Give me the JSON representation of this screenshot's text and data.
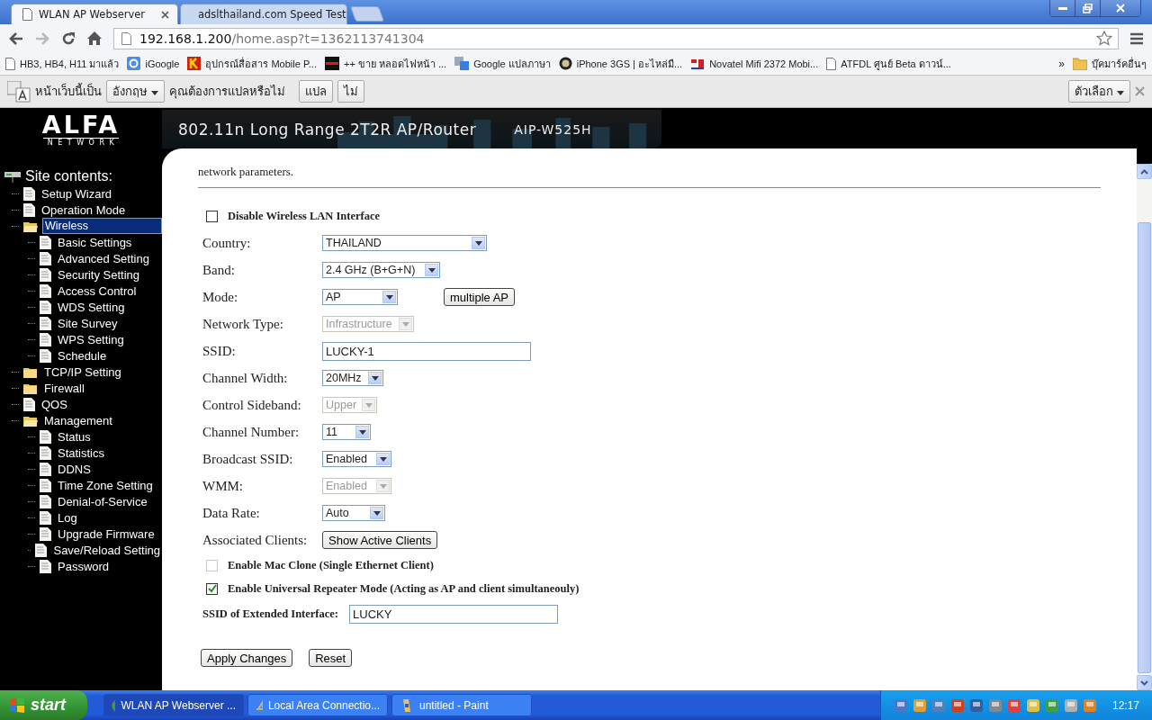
{
  "window": {
    "tabs": [
      {
        "title": "WLAN AP Webserver",
        "selected": true
      },
      {
        "title": "adslthailand.com Speed Test",
        "selected": false
      }
    ],
    "address": {
      "host": "192.168.1.200",
      "path": "/home.asp?t=1362113741304"
    },
    "bookmarks": [
      {
        "title": "HB3, HB4, H11 มาแล้ว",
        "kind": "page"
      },
      {
        "title": "iGoogle",
        "kind": "g"
      },
      {
        "title": "อุปกรณ์สื่อสาร Mobile P...",
        "kind": "k"
      },
      {
        "title": "++ ขาย หลอดไฟหน้า ...",
        "kind": "civic"
      },
      {
        "title": "Google แปลภาษา",
        "kind": "translate"
      },
      {
        "title": "iPhone 3GS | อะไหล่มื...",
        "kind": "round"
      },
      {
        "title": "Novatel Mifi 2372 Mobi...",
        "kind": "sn"
      },
      {
        "title": "ATFDL ศูนย์ Beta ดาวน์...",
        "kind": "page"
      }
    ],
    "more": "»",
    "other_bookmarks": "บุ๊คมาร์คอื่นๆ",
    "translate_bar": {
      "lead": "หน้าเว็บนี้เป็น",
      "language": "อังกฤษ",
      "question": "คุณต้องการแปลหรือไม่",
      "translate": "แปล",
      "decline": "ไม่",
      "options": "ตัวเลือก"
    }
  },
  "banner": {
    "logo": "ALFA",
    "logo_sub": "NETWORK",
    "title": "802.11n Long Range 2T2R AP/Router",
    "model": "AIP-W525H"
  },
  "sidebar": {
    "heading": "Site contents:",
    "items": [
      {
        "label": "Setup Wizard",
        "kind": "page",
        "selected": false
      },
      {
        "label": "Operation Mode",
        "kind": "page",
        "selected": false
      },
      {
        "label": "Wireless",
        "kind": "folder",
        "expanded": true,
        "selected": true,
        "children": [
          {
            "label": "Basic Settings",
            "kind": "page",
            "selected": false
          },
          {
            "label": "Advanced Setting",
            "kind": "page",
            "selected": false
          },
          {
            "label": "Security Setting",
            "kind": "page",
            "selected": false
          },
          {
            "label": "Access Control",
            "kind": "page",
            "selected": false
          },
          {
            "label": "WDS Setting",
            "kind": "page",
            "selected": false
          },
          {
            "label": "Site Survey",
            "kind": "page",
            "selected": false
          },
          {
            "label": "WPS Setting",
            "kind": "page",
            "selected": false
          },
          {
            "label": "Schedule",
            "kind": "page",
            "selected": false
          }
        ]
      },
      {
        "label": "TCP/IP Setting",
        "kind": "folder",
        "expanded": false,
        "selected": false
      },
      {
        "label": "Firewall",
        "kind": "folder",
        "expanded": false,
        "selected": false
      },
      {
        "label": "QOS",
        "kind": "page",
        "selected": false
      },
      {
        "label": "Management",
        "kind": "folder",
        "expanded": true,
        "selected": false,
        "children": [
          {
            "label": "Status",
            "kind": "page",
            "selected": false
          },
          {
            "label": "Statistics",
            "kind": "page",
            "selected": false
          },
          {
            "label": "DDNS",
            "kind": "page",
            "selected": false
          },
          {
            "label": "Time Zone Setting",
            "kind": "page",
            "selected": false
          },
          {
            "label": "Denial-of-Service",
            "kind": "page",
            "selected": false
          },
          {
            "label": "Log",
            "kind": "page",
            "selected": false
          },
          {
            "label": "Upgrade Firmware",
            "kind": "page",
            "selected": false
          },
          {
            "label": "Save/Reload Setting",
            "kind": "page",
            "selected": false
          },
          {
            "label": "Password",
            "kind": "page",
            "selected": false
          }
        ]
      }
    ]
  },
  "page": {
    "intro": "network parameters.",
    "disable_wlan": {
      "label": "Disable Wireless LAN Interface",
      "checked": false,
      "disabled": false
    },
    "fields": [
      {
        "label": "Country:",
        "kind": "select",
        "value": "THAILAND",
        "disabled": false
      },
      {
        "label": "Band:",
        "kind": "select",
        "value": "2.4 GHz (B+G+N)",
        "disabled": false
      },
      {
        "label": "Mode:",
        "kind": "select",
        "value": "AP",
        "disabled": false,
        "button": "multiple AP"
      },
      {
        "label": "Network Type:",
        "kind": "select",
        "value": "Infrastructure",
        "disabled": true
      },
      {
        "label": "SSID:",
        "kind": "text",
        "value": "LUCKY-1",
        "disabled": false
      },
      {
        "label": "Channel Width:",
        "kind": "select",
        "value": "20MHz",
        "disabled": false
      },
      {
        "label": "Control Sideband:",
        "kind": "select",
        "value": "Upper",
        "disabled": true
      },
      {
        "label": "Channel Number:",
        "kind": "select",
        "value": "11",
        "disabled": false
      },
      {
        "label": "Broadcast SSID:",
        "kind": "select",
        "value": "Enabled",
        "disabled": false
      },
      {
        "label": "WMM:",
        "kind": "select",
        "value": "Enabled",
        "disabled": true
      },
      {
        "label": "Data Rate:",
        "kind": "select",
        "value": "Auto",
        "disabled": false
      },
      {
        "label": "Associated Clients:",
        "kind": "button",
        "value": "Show Active Clients",
        "disabled": false
      }
    ],
    "options": [
      {
        "label": "Enable Mac Clone (Single Ethernet Client)",
        "checked": false,
        "disabled": true
      },
      {
        "label": "Enable Universal Repeater Mode (Acting as AP and client simultaneouly)",
        "checked": true,
        "disabled": false
      }
    ],
    "extended_ssid": {
      "label": "SSID of Extended Interface:",
      "value": "LUCKY"
    },
    "buttons": [
      "Apply Changes",
      "Reset"
    ]
  },
  "taskbar": {
    "start": "start",
    "tasks": [
      {
        "title": "WLAN AP Webserver ...",
        "kind": "chrome",
        "selected": true
      },
      {
        "title": "Local Area Connectio...",
        "kind": "network",
        "selected": false
      },
      {
        "title": "untitled - Paint",
        "kind": "paint",
        "selected": false
      }
    ],
    "clock": "12:17"
  }
}
